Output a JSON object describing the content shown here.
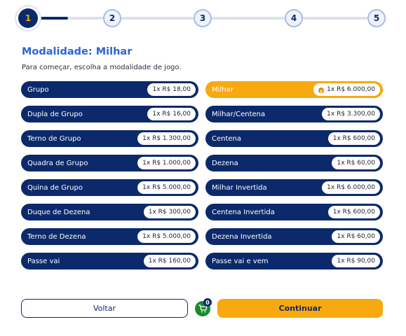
{
  "stepper": {
    "steps": [
      "1",
      "2",
      "3",
      "4",
      "5"
    ],
    "current": 1
  },
  "title": "Modalidade: Milhar",
  "subtitle": "Para começar, escolha a modalidade de jogo.",
  "options_left": [
    {
      "label": "Grupo",
      "price": "1x R$ 18,00"
    },
    {
      "label": "Dupla de Grupo",
      "price": "1x R$ 16,00"
    },
    {
      "label": "Terno de Grupo",
      "price": "1x R$ 1.300,00"
    },
    {
      "label": "Quadra de Grupo",
      "price": "1x R$ 1.000,00"
    },
    {
      "label": "Quina de Grupo",
      "price": "1x R$ 5.000,00"
    },
    {
      "label": "Duque de Dezena",
      "price": "1x R$ 300,00"
    },
    {
      "label": "Terno de Dezena",
      "price": "1x R$ 5.000,00"
    },
    {
      "label": "Passe vai",
      "price": "1x R$ 160,00"
    }
  ],
  "options_right": [
    {
      "label": "Milhar",
      "price": "1x R$ 6.000,00",
      "selected": true,
      "icon": "fire-icon"
    },
    {
      "label": "Milhar/Centena",
      "price": "1x R$ 3.300,00"
    },
    {
      "label": "Centena",
      "price": "1x R$ 600,00"
    },
    {
      "label": "Dezena",
      "price": "1x R$ 60,00"
    },
    {
      "label": "Milhar Invertida",
      "price": "1x R$ 6.000,00"
    },
    {
      "label": "Centena Invertida",
      "price": "1x R$ 600,00"
    },
    {
      "label": "Dezena Invertida",
      "price": "1x R$ 60,00"
    },
    {
      "label": "Passe vai e vem",
      "price": "1x R$ 90,00"
    }
  ],
  "footer": {
    "back_label": "Voltar",
    "cart_count": "0",
    "continue_label": "Continuar"
  },
  "colors": {
    "navy": "#0c2a6b",
    "accent": "#f7a90f",
    "title_blue": "#2d64d6",
    "cart_green": "#1a8a2c"
  }
}
